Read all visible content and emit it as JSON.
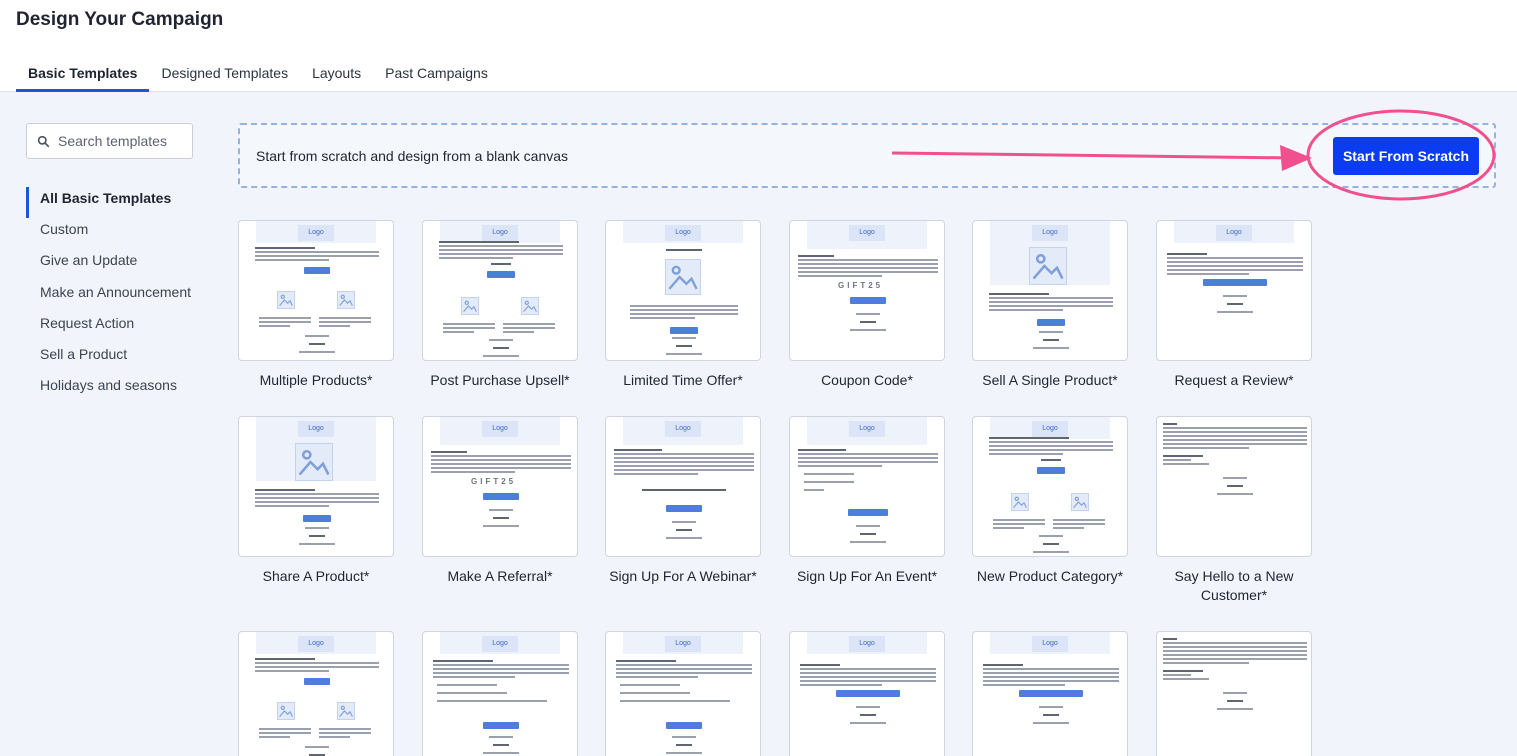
{
  "header": {
    "title": "Design Your Campaign",
    "tabs": [
      {
        "label": "Basic Templates",
        "active": true
      },
      {
        "label": "Designed Templates",
        "active": false
      },
      {
        "label": "Layouts",
        "active": false
      },
      {
        "label": "Past Campaigns",
        "active": false
      }
    ]
  },
  "search": {
    "placeholder": "Search templates",
    "icon": "search-icon"
  },
  "sidebar": {
    "items": [
      {
        "label": "All Basic Templates",
        "active": true
      },
      {
        "label": "Custom",
        "active": false
      },
      {
        "label": "Give an Update",
        "active": false
      },
      {
        "label": "Make an Announcement",
        "active": false
      },
      {
        "label": "Request Action",
        "active": false
      },
      {
        "label": "Sell a Product",
        "active": false
      },
      {
        "label": "Holidays and seasons",
        "active": false
      }
    ]
  },
  "scratch": {
    "text": "Start from scratch and design from a blank canvas",
    "button_label": "Start From Scratch"
  },
  "thumbnail": {
    "logo_text": "Logo",
    "gift_code": "GIFT25"
  },
  "templates": [
    {
      "label": "Multiple Products*",
      "layout": "two-products"
    },
    {
      "label": "Post Purchase Upsell*",
      "layout": "two-products-text"
    },
    {
      "label": "Limited Time Offer*",
      "layout": "hero-image"
    },
    {
      "label": "Coupon Code*",
      "layout": "coupon"
    },
    {
      "label": "Sell A Single Product*",
      "layout": "single-product"
    },
    {
      "label": "Request a Review*",
      "layout": "text-button"
    },
    {
      "label": "Share A Product*",
      "layout": "single-product"
    },
    {
      "label": "Make A Referral*",
      "layout": "coupon"
    },
    {
      "label": "Sign Up For A Webinar*",
      "layout": "webinar"
    },
    {
      "label": "Sign Up For An Event*",
      "layout": "event"
    },
    {
      "label": "New Product Category*",
      "layout": "two-products-text"
    },
    {
      "label": "Say Hello to a New Customer*",
      "layout": "letter"
    },
    {
      "label": "",
      "layout": "two-products"
    },
    {
      "label": "",
      "layout": "bullets"
    },
    {
      "label": "",
      "layout": "bullets"
    },
    {
      "label": "",
      "layout": "text-button"
    },
    {
      "label": "",
      "layout": "text-button"
    },
    {
      "label": "",
      "layout": "letter"
    }
  ],
  "colors": {
    "accent": "#1a56d6",
    "primary_button": "#0b3cf0",
    "annotation": "#f0518e"
  }
}
